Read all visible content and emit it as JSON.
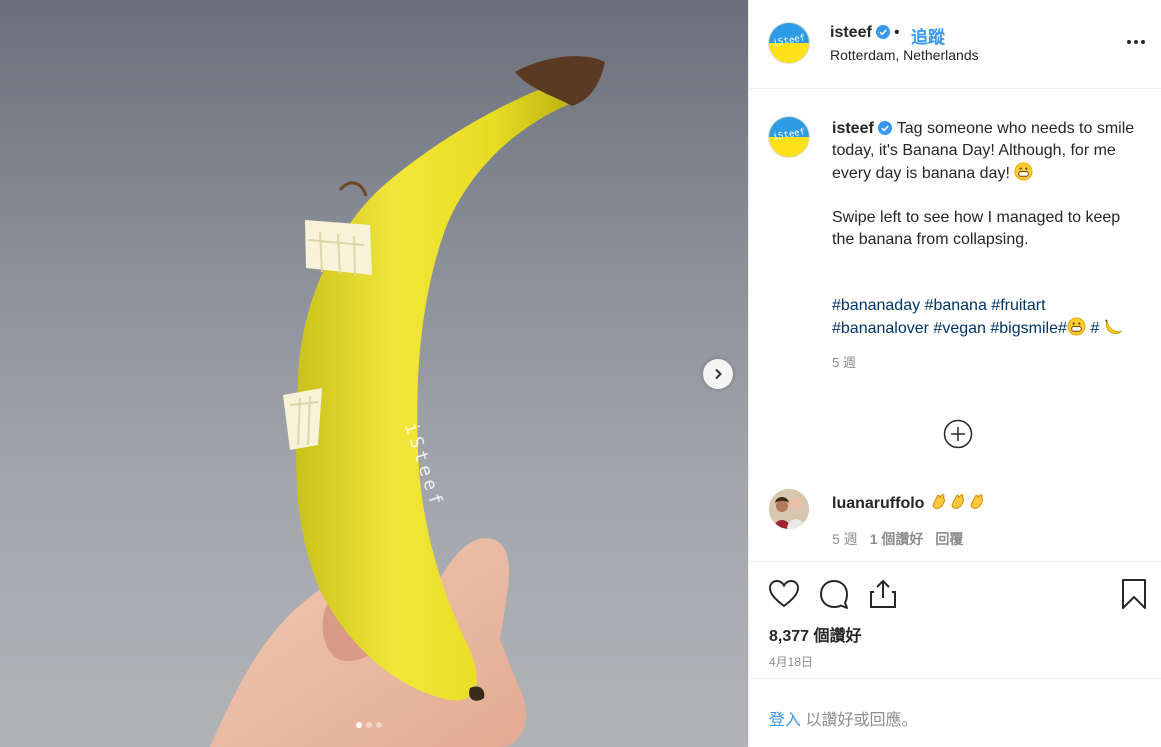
{
  "post": {
    "carousel_position": "1 / 3",
    "watermark": "iSteef"
  },
  "header": {
    "username": "isteef",
    "separator": "•",
    "follow_label": "追蹤",
    "location": "Rotterdam, Netherlands",
    "more_icon": "more-options-icon"
  },
  "caption": {
    "username": "isteef",
    "line1": "Tag someone who needs to smile today, it's Banana Day! Although, for me every day is banana day!",
    "line2": "Swipe left to see how I managed to keep the banana from collapsing.",
    "hashtags": [
      "#bananaday",
      "#banana",
      "#fruitart",
      "#bananalover",
      "#vegan",
      "#bigsmile"
    ],
    "hash_tail_1": "#",
    "hash_tail_2": "#",
    "time": "5 週"
  },
  "comment": {
    "username": "luanaruffolo",
    "time": "5 週",
    "likes": "1 個讚好",
    "reply": "回覆"
  },
  "actions": {
    "likes_count": "8,377 個讚好",
    "date": "4月18日"
  },
  "login": {
    "link": "登入",
    "rest": " 以讚好或回應。"
  },
  "colors": {
    "accent": "#3897f0",
    "hashtag": "#003569",
    "verified": "#3897f0",
    "banana": "#f2e21c"
  }
}
